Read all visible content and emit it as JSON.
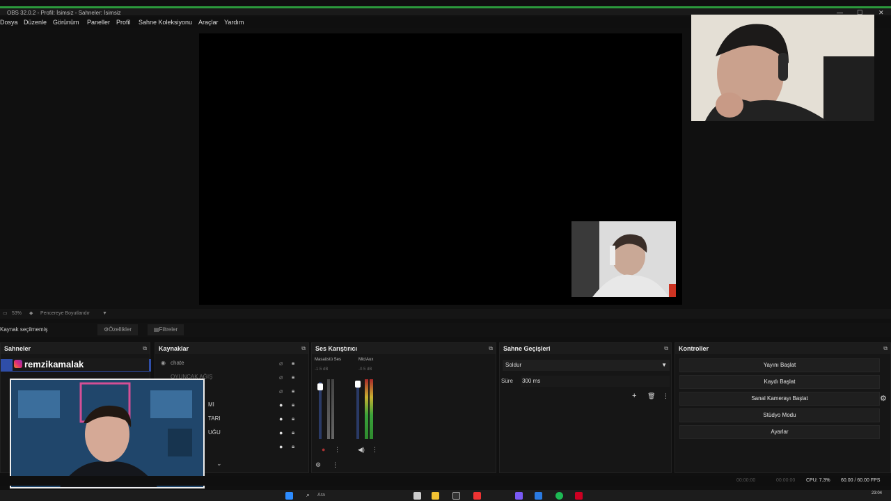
{
  "window": {
    "title": "OBS 32.0.2 - Profil: İsimsiz - Sahneler: İsimsiz"
  },
  "menu": [
    "Dosya",
    "Düzenle",
    "Görünüm",
    "Paneller",
    "Profil",
    "Sahne Koleksiyonu",
    "Araçlar",
    "Yardım"
  ],
  "zoom": {
    "level": "53%",
    "mode": "Pencereye Boyutlandır"
  },
  "source_bar": {
    "status": "Kaynak seçilmemiş",
    "properties": "Özellikler",
    "filters": "Filtreler"
  },
  "docks": {
    "scenes": {
      "title": "Sahneler"
    },
    "sources": {
      "title": "Kaynaklar",
      "items": [
        "chate",
        "OYUNCAK AĞIŞ",
        "",
        "MI",
        "TARI",
        "UĞU"
      ]
    },
    "mixer": {
      "title": "Ses Karıştırıcı",
      "channels": [
        {
          "name": "Masaüstü Ses",
          "db": "-1.5 dB"
        },
        {
          "name": "Mic/Aux",
          "db": "-0.5 dB"
        }
      ]
    },
    "transitions": {
      "title": "Sahne Geçişleri",
      "type": "Soldur",
      "duration_label": "Süre",
      "duration_value": "300 ms"
    },
    "controls": {
      "title": "Kontroller",
      "buttons": [
        "Yayını Başlat",
        "Kaydı Başlat",
        "Sanal Kamerayı Başlat",
        "Stüdyo Modu",
        "Ayarlar"
      ]
    }
  },
  "overlay": {
    "instagram_handle": "remzikamalak"
  },
  "status": {
    "stream_time": "00:00:00",
    "rec_time": "00:00:00",
    "cpu": "CPU: 7.3%",
    "fps": "60.00 / 60.00 FPS"
  },
  "taskbar": {
    "search": "Ara",
    "clock": "23:04"
  },
  "colors": {
    "titlebar_accent": "#2b9a3c",
    "selection": "#2f4ea8"
  },
  "icons": [
    "gear-icon",
    "eye-icon",
    "lock-icon",
    "trash-icon",
    "plus-icon",
    "mute-icon",
    "windows-icon",
    "search-icon"
  ]
}
